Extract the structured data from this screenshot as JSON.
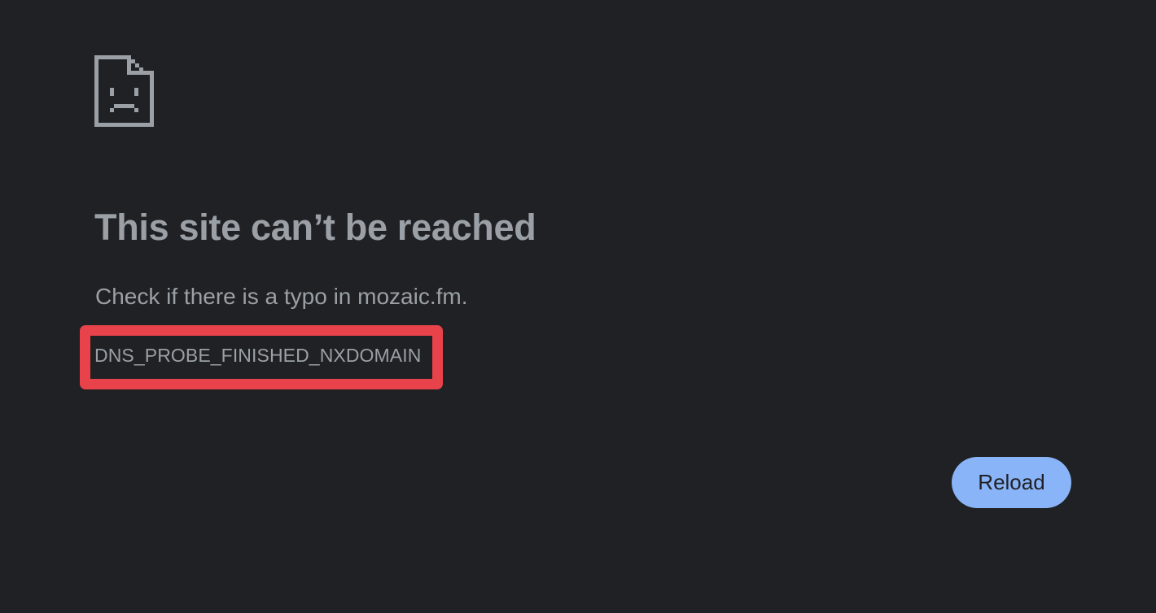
{
  "colors": {
    "background": "#202124",
    "text": "#9aa0a6",
    "highlight": "#e8424a",
    "button_background": "#8ab4f8",
    "button_text": "#202124"
  },
  "icon": {
    "name": "sad-page-icon"
  },
  "error": {
    "title": "This site can’t be reached",
    "message": "Check if there is a typo in mozaic.fm.",
    "code": "DNS_PROBE_FINISHED_NXDOMAIN"
  },
  "actions": {
    "reload_label": "Reload"
  }
}
